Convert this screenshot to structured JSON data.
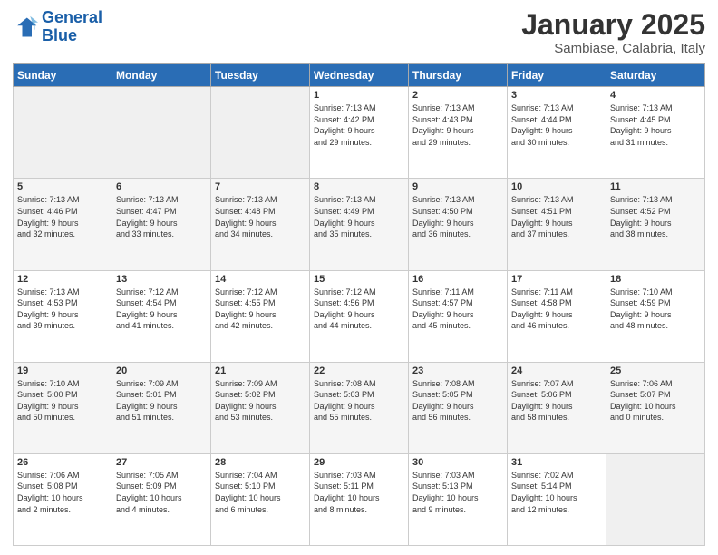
{
  "header": {
    "logo_line1": "General",
    "logo_line2": "Blue",
    "title": "January 2025",
    "subtitle": "Sambiase, Calabria, Italy"
  },
  "weekdays": [
    "Sunday",
    "Monday",
    "Tuesday",
    "Wednesday",
    "Thursday",
    "Friday",
    "Saturday"
  ],
  "weeks": [
    [
      {
        "day": "",
        "info": ""
      },
      {
        "day": "",
        "info": ""
      },
      {
        "day": "",
        "info": ""
      },
      {
        "day": "1",
        "info": "Sunrise: 7:13 AM\nSunset: 4:42 PM\nDaylight: 9 hours\nand 29 minutes."
      },
      {
        "day": "2",
        "info": "Sunrise: 7:13 AM\nSunset: 4:43 PM\nDaylight: 9 hours\nand 29 minutes."
      },
      {
        "day": "3",
        "info": "Sunrise: 7:13 AM\nSunset: 4:44 PM\nDaylight: 9 hours\nand 30 minutes."
      },
      {
        "day": "4",
        "info": "Sunrise: 7:13 AM\nSunset: 4:45 PM\nDaylight: 9 hours\nand 31 minutes."
      }
    ],
    [
      {
        "day": "5",
        "info": "Sunrise: 7:13 AM\nSunset: 4:46 PM\nDaylight: 9 hours\nand 32 minutes."
      },
      {
        "day": "6",
        "info": "Sunrise: 7:13 AM\nSunset: 4:47 PM\nDaylight: 9 hours\nand 33 minutes."
      },
      {
        "day": "7",
        "info": "Sunrise: 7:13 AM\nSunset: 4:48 PM\nDaylight: 9 hours\nand 34 minutes."
      },
      {
        "day": "8",
        "info": "Sunrise: 7:13 AM\nSunset: 4:49 PM\nDaylight: 9 hours\nand 35 minutes."
      },
      {
        "day": "9",
        "info": "Sunrise: 7:13 AM\nSunset: 4:50 PM\nDaylight: 9 hours\nand 36 minutes."
      },
      {
        "day": "10",
        "info": "Sunrise: 7:13 AM\nSunset: 4:51 PM\nDaylight: 9 hours\nand 37 minutes."
      },
      {
        "day": "11",
        "info": "Sunrise: 7:13 AM\nSunset: 4:52 PM\nDaylight: 9 hours\nand 38 minutes."
      }
    ],
    [
      {
        "day": "12",
        "info": "Sunrise: 7:13 AM\nSunset: 4:53 PM\nDaylight: 9 hours\nand 39 minutes."
      },
      {
        "day": "13",
        "info": "Sunrise: 7:12 AM\nSunset: 4:54 PM\nDaylight: 9 hours\nand 41 minutes."
      },
      {
        "day": "14",
        "info": "Sunrise: 7:12 AM\nSunset: 4:55 PM\nDaylight: 9 hours\nand 42 minutes."
      },
      {
        "day": "15",
        "info": "Sunrise: 7:12 AM\nSunset: 4:56 PM\nDaylight: 9 hours\nand 44 minutes."
      },
      {
        "day": "16",
        "info": "Sunrise: 7:11 AM\nSunset: 4:57 PM\nDaylight: 9 hours\nand 45 minutes."
      },
      {
        "day": "17",
        "info": "Sunrise: 7:11 AM\nSunset: 4:58 PM\nDaylight: 9 hours\nand 46 minutes."
      },
      {
        "day": "18",
        "info": "Sunrise: 7:10 AM\nSunset: 4:59 PM\nDaylight: 9 hours\nand 48 minutes."
      }
    ],
    [
      {
        "day": "19",
        "info": "Sunrise: 7:10 AM\nSunset: 5:00 PM\nDaylight: 9 hours\nand 50 minutes."
      },
      {
        "day": "20",
        "info": "Sunrise: 7:09 AM\nSunset: 5:01 PM\nDaylight: 9 hours\nand 51 minutes."
      },
      {
        "day": "21",
        "info": "Sunrise: 7:09 AM\nSunset: 5:02 PM\nDaylight: 9 hours\nand 53 minutes."
      },
      {
        "day": "22",
        "info": "Sunrise: 7:08 AM\nSunset: 5:03 PM\nDaylight: 9 hours\nand 55 minutes."
      },
      {
        "day": "23",
        "info": "Sunrise: 7:08 AM\nSunset: 5:05 PM\nDaylight: 9 hours\nand 56 minutes."
      },
      {
        "day": "24",
        "info": "Sunrise: 7:07 AM\nSunset: 5:06 PM\nDaylight: 9 hours\nand 58 minutes."
      },
      {
        "day": "25",
        "info": "Sunrise: 7:06 AM\nSunset: 5:07 PM\nDaylight: 10 hours\nand 0 minutes."
      }
    ],
    [
      {
        "day": "26",
        "info": "Sunrise: 7:06 AM\nSunset: 5:08 PM\nDaylight: 10 hours\nand 2 minutes."
      },
      {
        "day": "27",
        "info": "Sunrise: 7:05 AM\nSunset: 5:09 PM\nDaylight: 10 hours\nand 4 minutes."
      },
      {
        "day": "28",
        "info": "Sunrise: 7:04 AM\nSunset: 5:10 PM\nDaylight: 10 hours\nand 6 minutes."
      },
      {
        "day": "29",
        "info": "Sunrise: 7:03 AM\nSunset: 5:11 PM\nDaylight: 10 hours\nand 8 minutes."
      },
      {
        "day": "30",
        "info": "Sunrise: 7:03 AM\nSunset: 5:13 PM\nDaylight: 10 hours\nand 9 minutes."
      },
      {
        "day": "31",
        "info": "Sunrise: 7:02 AM\nSunset: 5:14 PM\nDaylight: 10 hours\nand 12 minutes."
      },
      {
        "day": "",
        "info": ""
      }
    ]
  ]
}
